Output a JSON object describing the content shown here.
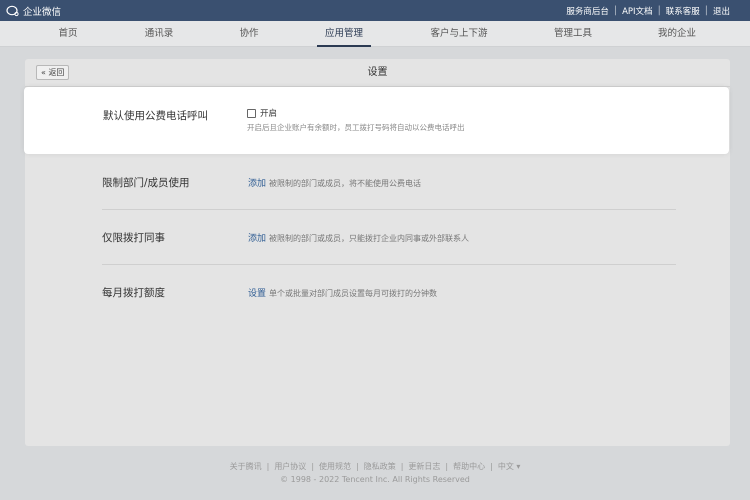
{
  "topbar": {
    "brand": "企业微信",
    "links": [
      "服务商后台",
      "API文档",
      "联系客服",
      "退出"
    ]
  },
  "nav": {
    "tabs": [
      "首页",
      "通讯录",
      "协作",
      "应用管理",
      "客户与上下游",
      "管理工具",
      "我的企业"
    ],
    "active": "应用管理"
  },
  "panel": {
    "back_label": "« 返回",
    "title": "设置"
  },
  "settings": {
    "default_call": {
      "label": "默认使用公费电话呼叫",
      "checkbox_label": "开启",
      "checked": false,
      "description": "开启后且企业账户有余额时，员工拨打号码将自动以公费电话呼出"
    },
    "restrict_members": {
      "label": "限制部门/成员使用",
      "action": "添加",
      "description": "被限制的部门或成员，将不能使用公费电话"
    },
    "only_colleagues": {
      "label": "仅限拨打同事",
      "action": "添加",
      "description": "被限制的部门或成员，只能拨打企业内同事或外部联系人"
    },
    "monthly_quota": {
      "label": "每月拨打额度",
      "action": "设置",
      "description": "单个或批量对部门成员设置每月可拨打的分钟数"
    }
  },
  "footer": {
    "links": [
      "关于腾讯",
      "用户协议",
      "使用规范",
      "隐私政策",
      "更新日志",
      "帮助中心",
      "中文 ▾"
    ],
    "copyright": "© 1998 - 2022 Tencent Inc. All Rights Reserved"
  },
  "colors": {
    "topbar": "#3a5070",
    "accent_link": "#2f5d93",
    "page_bg": "#d6d8da"
  }
}
